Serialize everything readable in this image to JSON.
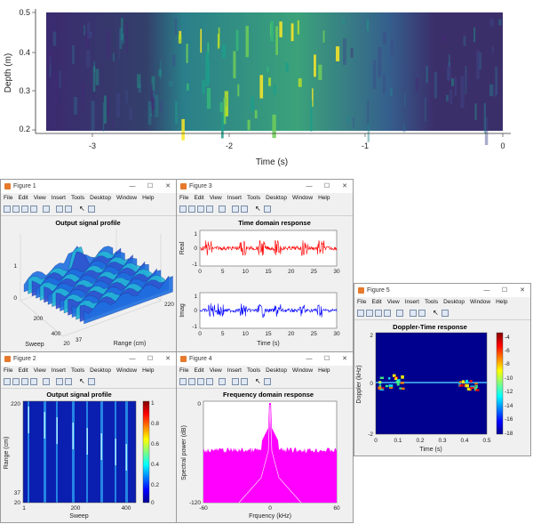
{
  "top_plot": {
    "xlabel": "Time (s)",
    "ylabel": "Depth (m)",
    "x_ticks": [
      "-3",
      "-2",
      "-1",
      "0"
    ],
    "y_ticks": [
      "0.2",
      "0.3",
      "0.4",
      "0.5"
    ],
    "colors": {
      "bg": "#440154",
      "mid": "#31688e",
      "high": "#35b779",
      "peak": "#fde725"
    }
  },
  "windows": {
    "fig1": {
      "title": "Figure 1",
      "menu": [
        "File",
        "Edit",
        "View",
        "Insert",
        "Tools",
        "Desktop",
        "Window",
        "Help"
      ],
      "plot_title": "Output signal profile",
      "xlabel": "Sweep",
      "ylabel": "Range (cm)",
      "z_ticks": [
        "0",
        "1"
      ],
      "sweep_ticks": [
        "200",
        "400"
      ],
      "range_ticks": [
        "20",
        "37",
        "220"
      ]
    },
    "fig2": {
      "title": "Figure 2",
      "menu": [
        "File",
        "Edit",
        "View",
        "Insert",
        "Tools",
        "Desktop",
        "Window",
        "Help"
      ],
      "plot_title": "Output signal profile",
      "xlabel": "Sweep",
      "ylabel": "Range (cm)",
      "x_ticks": [
        "1",
        "200",
        "400"
      ],
      "y_ticks": [
        "220",
        "37",
        "20"
      ],
      "cbar_ticks": [
        "1",
        "0.8",
        "0.6",
        "0.4",
        "0.2",
        "0"
      ]
    },
    "fig3": {
      "title": "Figure 3",
      "menu": [
        "File",
        "Edit",
        "View",
        "Insert",
        "Tools",
        "Desktop",
        "Window",
        "Help"
      ],
      "plot_title": "Time domain response",
      "real_label": "Real",
      "imag_label": "Imag",
      "xlabel": "Time (s)",
      "x_ticks": [
        "0",
        "5",
        "10",
        "15",
        "20",
        "25",
        "30"
      ],
      "y_ticks_real": [
        "1",
        "0",
        "-1"
      ],
      "y_ticks_imag": [
        "1",
        "0",
        "-1"
      ]
    },
    "fig4": {
      "title": "Figure 4",
      "menu": [
        "File",
        "Edit",
        "View",
        "Insert",
        "Tools",
        "Desktop",
        "Window",
        "Help"
      ],
      "plot_title": "Frequency domain response",
      "xlabel": "Frquency (kHz)",
      "ylabel": "Spectral power (dB)",
      "x_ticks": [
        "-60",
        "0",
        "60"
      ],
      "y_ticks": [
        "0",
        "-120"
      ]
    },
    "fig5": {
      "title": "Figure 5",
      "menu": [
        "File",
        "Edit",
        "View",
        "Insert",
        "Tools",
        "Desktop",
        "Window",
        "Help"
      ],
      "plot_title": "Doppler-Time response",
      "xlabel": "Time (s)",
      "ylabel": "Doppler (kHz)",
      "x_ticks": [
        "0",
        "0.1",
        "0.2",
        "0.3",
        "0.4",
        "0.5"
      ],
      "y_ticks": [
        "2",
        "0",
        "-2"
      ],
      "cbar_ticks": [
        "-4",
        "-6",
        "-8",
        "-10",
        "-12",
        "-14",
        "-16",
        "-18"
      ]
    }
  }
}
